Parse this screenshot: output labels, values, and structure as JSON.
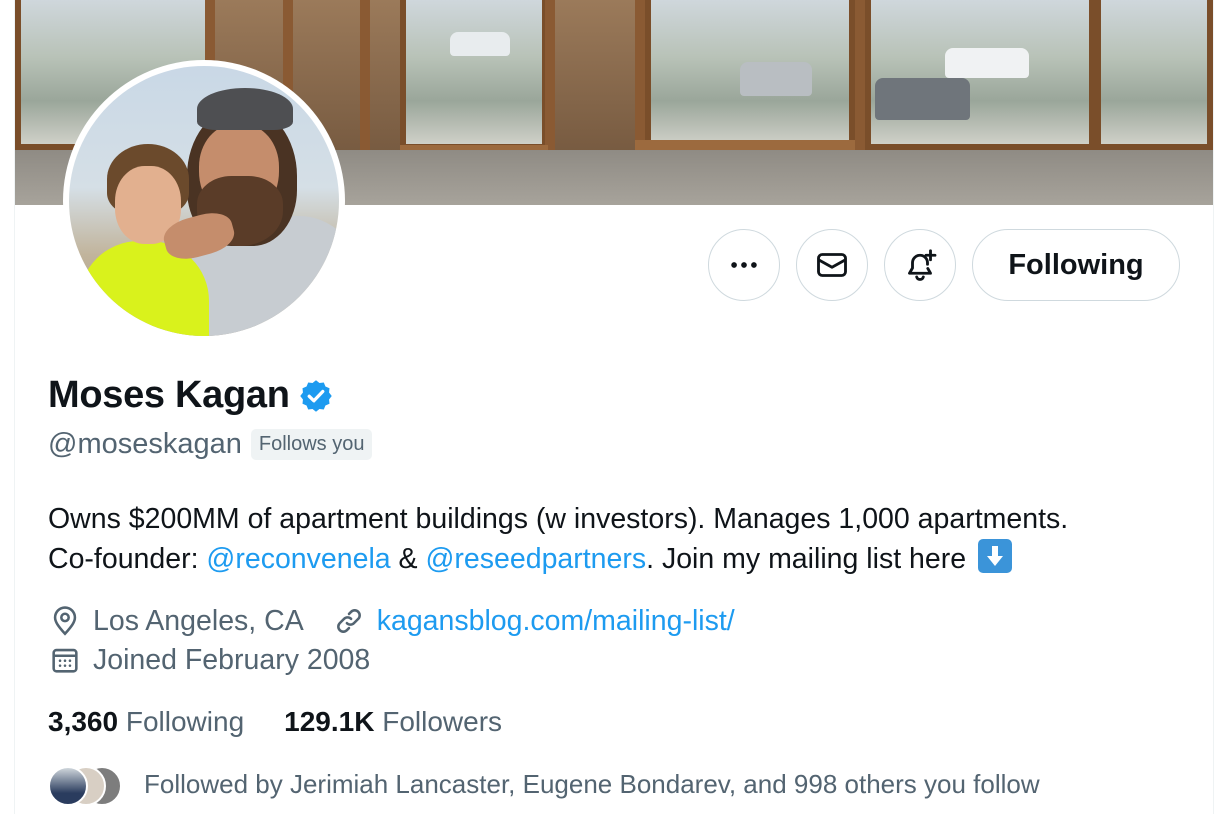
{
  "profile": {
    "name": "Moses Kagan",
    "handle": "@moseskagan",
    "follows_you": "Follows you",
    "bio": {
      "line1": "Owns $200MM of apartment buildings (w investors). Manages 1,000 apartments.",
      "line2_prefix": "Co-founder: ",
      "mention1": "@reconvenela",
      "amp": " & ",
      "mention2": "@reseedpartners",
      "line2_suffix": ". Join my mailing list here"
    },
    "location": "Los Angeles, CA",
    "website": "kagansblog.com/mailing-list/",
    "joined": "Joined February 2008",
    "stats": {
      "following_count": "3,360",
      "following_label": "Following",
      "followers_count": "129.1K",
      "followers_label": "Followers"
    },
    "followed_by": "Followed by Jerimiah Lancaster, Eugene Bondarev, and 998 others you follow"
  },
  "actions": {
    "more_icon": "more-icon",
    "message_icon": "envelope-icon",
    "notify_icon": "bell-plus-icon",
    "following_label": "Following"
  },
  "colors": {
    "accent": "#1d9bf0",
    "text": "#0f1419",
    "muted": "#536471",
    "border": "#cfd9de"
  }
}
